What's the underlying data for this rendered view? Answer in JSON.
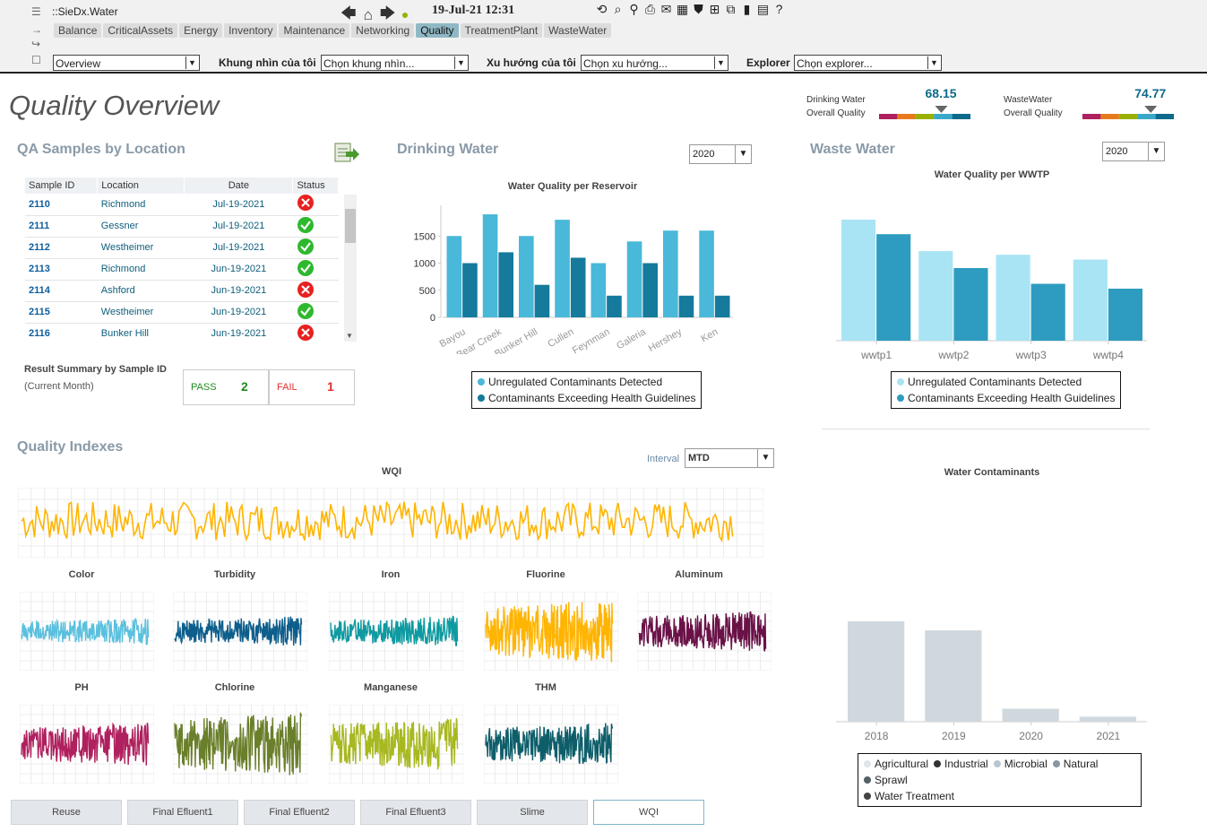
{
  "app": {
    "name": "::SieDx.Water",
    "clock": "19-Jul-21 12:31"
  },
  "menus": [
    "Balance",
    "CriticalAssets",
    "Energy",
    "Inventory",
    "Maintenance",
    "Networking",
    "Quality",
    "TreatmentPlant",
    "WasteWater"
  ],
  "active_menu": "Quality",
  "selectors": {
    "view": {
      "value": "Overview"
    },
    "my_view": {
      "label": "Khung nhìn của tôi",
      "value": "Chọn khung nhìn..."
    },
    "my_trend": {
      "label": "Xu hướng của tôi",
      "value": "Chọn xu hướng..."
    },
    "explorer": {
      "label": "Explorer",
      "value": "Chọn explorer..."
    }
  },
  "page_title": "Quality Overview",
  "gauges": [
    {
      "label1": "Drinking Water",
      "label2": "Overall Quality",
      "value": "68.15",
      "fraction": 0.6815
    },
    {
      "label1": "WasteWater",
      "label2": "Overall Quality",
      "value": "74.77",
      "fraction": 0.7477
    }
  ],
  "gauge_colors": [
    "#b0205e",
    "#e87a1e",
    "#9ab000",
    "#3aa8c8",
    "#0e6a8a"
  ],
  "qa": {
    "title": "QA Samples by Location",
    "headers": [
      "Sample ID",
      "Location",
      "Date",
      "Status"
    ],
    "rows": [
      {
        "id": "2110",
        "loc": "Richmond",
        "date": "Jul-19-2021",
        "status": "fail"
      },
      {
        "id": "2111",
        "loc": "Gessner",
        "date": "Jul-19-2021",
        "status": "pass"
      },
      {
        "id": "2112",
        "loc": "Westheimer",
        "date": "Jul-19-2021",
        "status": "pass"
      },
      {
        "id": "2113",
        "loc": "Richmond",
        "date": "Jun-19-2021",
        "status": "pass"
      },
      {
        "id": "2114",
        "loc": "Ashford",
        "date": "Jun-19-2021",
        "status": "fail"
      },
      {
        "id": "2115",
        "loc": "Westheimer",
        "date": "Jun-19-2021",
        "status": "pass"
      },
      {
        "id": "2116",
        "loc": "Bunker Hill",
        "date": "Jun-19-2021",
        "status": "fail"
      }
    ],
    "summary_label": "Result Summary by Sample ID",
    "summary_sub": "(Current Month)",
    "pass_label": "PASS",
    "pass_count": "2",
    "fail_label": "FAIL",
    "fail_count": "1"
  },
  "drinking": {
    "title": "Drinking Water",
    "year": "2020"
  },
  "waste": {
    "title": "Waste Water",
    "year": "2020"
  },
  "quality": {
    "title": "Quality Indexes",
    "interval_label": "Interval",
    "interval": "MTD",
    "wqi_title": "WQI"
  },
  "legend_series": [
    "Unregulated Contaminants Detected",
    "Contaminants Exceeding Health Guidelines"
  ],
  "contaminant_legend": [
    "Agricultural",
    "Industrial",
    "Microbial",
    "Natural",
    "Sprawl",
    "Water Treatment"
  ],
  "contaminant_colors": [
    "#dfe5ea",
    "#333333",
    "#b8c6cf",
    "#8a96a0",
    "#555f66",
    "#444444"
  ],
  "minis": [
    {
      "name": "Color",
      "color": "#5bc0de"
    },
    {
      "name": "Turbidity",
      "color": "#0e5e8c"
    },
    {
      "name": "Iron",
      "color": "#0e9aa0"
    },
    {
      "name": "Fluorine",
      "color": "#ffb400"
    },
    {
      "name": "Aluminum",
      "color": "#6a1248"
    },
    {
      "name": "PH",
      "color": "#b0205e"
    },
    {
      "name": "Chlorine",
      "color": "#6a7f2a"
    },
    {
      "name": "Manganese",
      "color": "#a8b820"
    },
    {
      "name": "THM",
      "color": "#0e5e6a"
    }
  ],
  "wqi_color": "#ffb400",
  "tabs": [
    "Reuse",
    "Final Efluent1",
    "Final Efluent2",
    "Final Efluent3",
    "Slime",
    "WQI"
  ],
  "active_tab": "WQI",
  "chart_data": [
    {
      "type": "bar",
      "title": "Water Quality per Reservoir",
      "categories": [
        "Bayou",
        "Bear Creek",
        "Bunker Hill",
        "Cullen",
        "Feynman",
        "Galeria",
        "Hershey",
        "Ken"
      ],
      "series": [
        {
          "name": "Unregulated Contaminants Detected",
          "color": "#4ab8d8",
          "values": [
            1500,
            1900,
            1500,
            1800,
            1000,
            1400,
            1600,
            1600
          ]
        },
        {
          "name": "Contaminants Exceeding Health Guidelines",
          "color": "#157a9c",
          "values": [
            1000,
            1200,
            600,
            1100,
            400,
            1000,
            400,
            400
          ]
        }
      ],
      "yticks": [
        0,
        500,
        1000,
        1500
      ],
      "ylim": [
        0,
        2000
      ]
    },
    {
      "type": "bar",
      "title": "Water Quality per WWTP",
      "categories": [
        "wwtp1",
        "wwtp2",
        "wwtp3",
        "wwtp4"
      ],
      "series": [
        {
          "name": "Unregulated Contaminants Detected",
          "color": "#a8e4f4",
          "values": [
            1.0,
            0.74,
            0.71,
            0.67
          ]
        },
        {
          "name": "Contaminants Exceeding Health Guidelines",
          "color": "#2e9cc0",
          "values": [
            0.88,
            0.6,
            0.47,
            0.43
          ]
        }
      ],
      "ylim": [
        0,
        1
      ]
    },
    {
      "type": "bar",
      "title": "Water Contaminants",
      "categories": [
        "2018",
        "2019",
        "2020",
        "2021"
      ],
      "series": [
        {
          "name": "Agricultural",
          "color": "#d0d8de",
          "values": [
            1.0,
            0.91,
            0.13,
            0.05
          ]
        }
      ],
      "ylim": [
        0,
        1
      ]
    }
  ]
}
